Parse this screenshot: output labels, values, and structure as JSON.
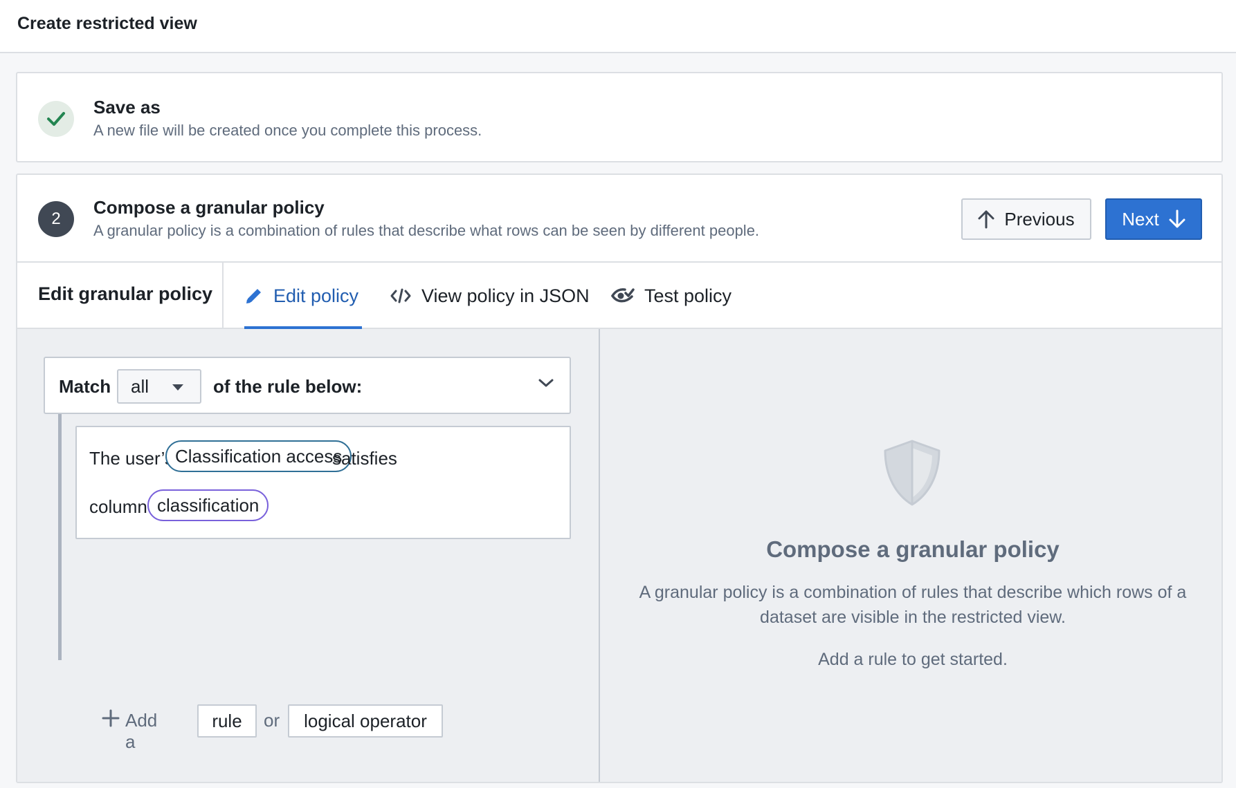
{
  "page": {
    "title": "Create restricted view"
  },
  "step1": {
    "title": "Save as",
    "subtitle": "A new file will be created once you complete this process.",
    "icon": "check-icon"
  },
  "step2": {
    "number": "2",
    "title": "Compose a granular policy",
    "subtitle": "A granular policy is a combination of rules that describe what rows can be seen by different people.",
    "previous_label": "Previous",
    "next_label": "Next"
  },
  "tabs": {
    "heading": "Edit granular policy",
    "items": [
      {
        "label": "Edit policy",
        "icon": "pencil-icon",
        "active": true
      },
      {
        "label": "View policy in JSON",
        "icon": "code-icon",
        "active": false
      },
      {
        "label": "Test policy",
        "icon": "eye-check-icon",
        "active": false
      }
    ]
  },
  "editor": {
    "match_label": "Match",
    "match_value": "all",
    "match_suffix": "of the rule below:",
    "rule": {
      "prefix": "The user’s",
      "user_attribute": "Classification access",
      "operator": "satisfies",
      "column_label": "column",
      "column_value": "classification"
    },
    "add": {
      "prefix": "Add a",
      "rule_label": "rule",
      "or_label": "or",
      "operator_label": "logical operator"
    }
  },
  "empty_state": {
    "icon": "shield-icon",
    "title": "Compose a granular policy",
    "description": "A granular policy is a combination of rules that describe which rows of a dataset are visible in the restricted view.",
    "hint": "Add a rule to get started."
  },
  "colors": {
    "primary": "#2d72d2",
    "success": "#238551",
    "user_attribute_pill": "#2f6f96",
    "column_pill": "#7961db"
  }
}
